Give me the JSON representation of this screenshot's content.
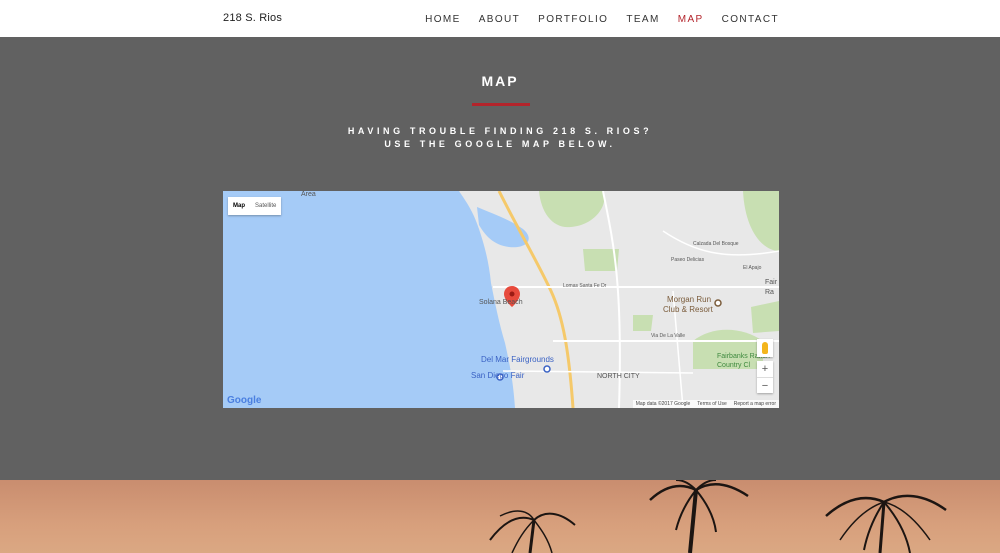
{
  "nav": {
    "brand": "218 S. Rios",
    "items": [
      {
        "label": "HOME",
        "active": false
      },
      {
        "label": "ABOUT",
        "active": false
      },
      {
        "label": "PORTFOLIO",
        "active": false
      },
      {
        "label": "TEAM",
        "active": false
      },
      {
        "label": "MAP",
        "active": true
      },
      {
        "label": "CONTACT",
        "active": false
      }
    ]
  },
  "map_section": {
    "title": "MAP",
    "subtitle_line1": "HAVING TROUBLE FINDING 218 S. RIOS?",
    "subtitle_line2": "USE THE GOOGLE MAP BELOW."
  },
  "map": {
    "type_map": "Map",
    "type_satellite": "Satellite",
    "zoom_in": "+",
    "zoom_out": "−",
    "logo": "Google",
    "attribution": {
      "data": "Map data ©2017 Google",
      "terms": "Terms of Use",
      "report": "Report a map error"
    },
    "labels": {
      "area": "Area",
      "solana_beach": "Solana Beach",
      "morgan_run": "Morgan Run",
      "club_resort": "Club & Resort",
      "del_mar_fairgrounds": "Del Mar Fairgrounds",
      "san_diego_fair": "San Diego Fair",
      "north_city": "NORTH CITY",
      "fairbanks_ranch": "Fairbanks Ranch",
      "country_club": "Country Cl",
      "fair": "Fair",
      "ra": "Ra",
      "el_camino_real": "El Camino Real",
      "lomas_santa_fe": "Lomas Santa Fe Dr",
      "via_de_la_valle": "Via De La Valle",
      "calzada_del_bosque": "Calzada Del Bosque",
      "paseo_delicias": "Paseo Delicias",
      "el_apajo": "El Apajo",
      "el_camino_del_norte": "El Camino Del Norte",
      "highway_5": "5"
    },
    "colors": {
      "water": "#a5cbf7",
      "land": "#e8e8e8",
      "park": "#c8dfb2",
      "highway": "#f5c96a",
      "road": "#ffffff",
      "marker": "#e74a3c"
    }
  },
  "colors": {
    "accent": "#b3242b",
    "section_bg": "#616161"
  }
}
